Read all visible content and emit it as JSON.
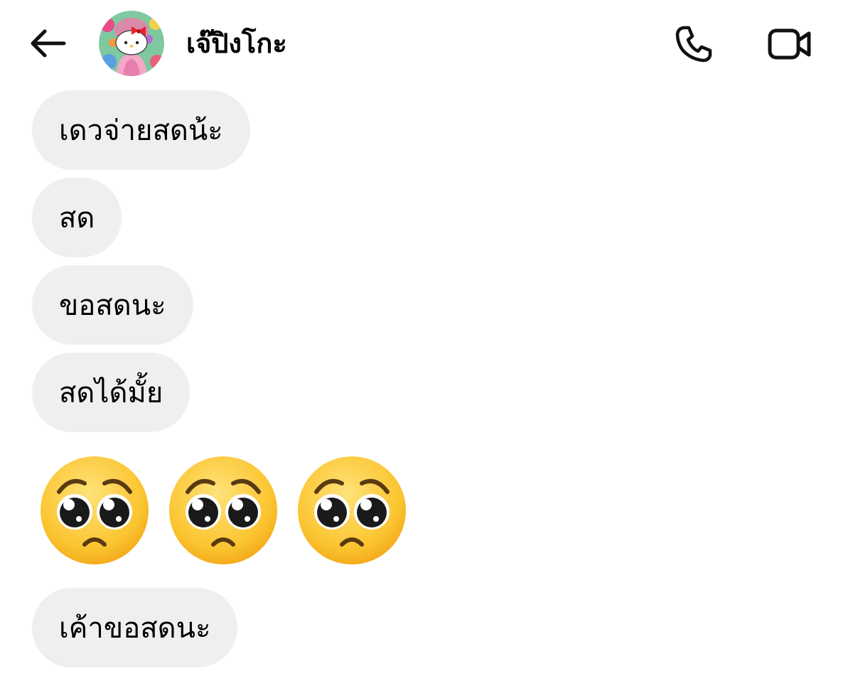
{
  "header": {
    "contact_name": "เจ๊ปิงโกะ",
    "back_icon": "arrow-left-icon",
    "call_icon": "phone-icon",
    "video_icon": "video-camera-icon"
  },
  "messages": [
    {
      "text": "เดวจ่ายสดน้ะ"
    },
    {
      "text": "สด"
    },
    {
      "text": "ขอสดนะ"
    },
    {
      "text": "สดได้มั้ย"
    },
    {
      "emoji": [
        "pleading-face",
        "pleading-face",
        "pleading-face"
      ]
    },
    {
      "text": "เค้าขอสดนะ"
    }
  ],
  "colors": {
    "bubble": "#efefef",
    "background": "#ffffff",
    "emoji_face": "#ffcc33"
  }
}
